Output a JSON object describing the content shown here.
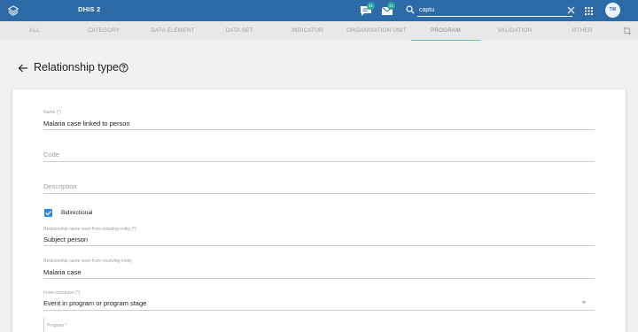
{
  "app": {
    "title": "DHIS 2",
    "interpretations_badge": "41",
    "messages_badge": "41",
    "search_value": "captu",
    "avatar_initials": "TW"
  },
  "tabs": [
    {
      "label": "ALL"
    },
    {
      "label": "CATEGORY"
    },
    {
      "label": "DATA ELEMENT"
    },
    {
      "label": "DATA SET"
    },
    {
      "label": "INDICATOR"
    },
    {
      "label": "ORGANISATION UNIT"
    },
    {
      "label": "PROGRAM",
      "active": true
    },
    {
      "label": "VALIDATION"
    },
    {
      "label": "OTHER"
    }
  ],
  "page": {
    "title": "Relationship type"
  },
  "form": {
    "name_label": "Name (*)",
    "name_value": "Malaria case linked to person",
    "code_placeholder": "Code",
    "description_placeholder": "Description",
    "bidirectional_label": "Bidirectional",
    "bidirectional_checked": true,
    "from_name_label": "Relationship name seen from initiating entity (*)",
    "from_name_value": "Subject person",
    "to_name_label": "Relationship name seen from receiving entity",
    "to_name_value": "Malaria case",
    "from_constraint_label": "From constraint (*)",
    "from_constraint_value": "Event in program or program stage",
    "program_label": "Program *"
  },
  "colors": {
    "header": "#2d6aa8",
    "badge": "#27a597",
    "active_tab_underline": "#ff9800",
    "checkbox": "#2d8ae0"
  },
  "icons": [
    "dhis2-logo-icon",
    "interpretations-icon",
    "messages-icon",
    "search-icon",
    "clear-icon",
    "apps-grid-icon",
    "pin-icon",
    "back-arrow-icon",
    "help-icon",
    "checkbox-checked-icon",
    "dropdown-arrow-icon"
  ]
}
